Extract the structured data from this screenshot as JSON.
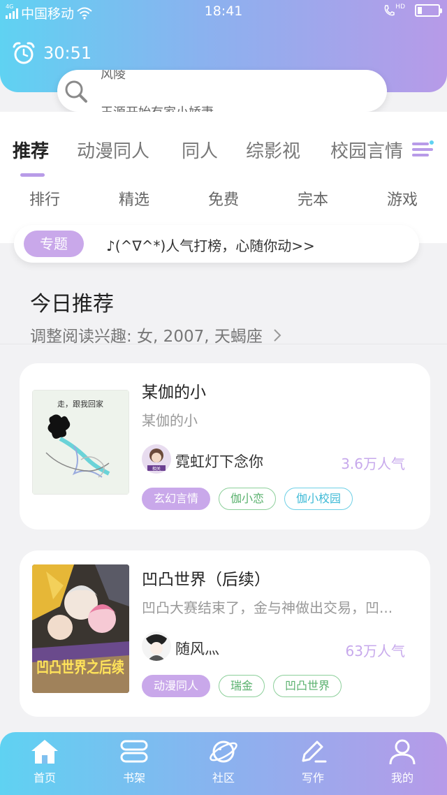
{
  "status_bar": {
    "network": "4G",
    "carrier": "中国移动",
    "time": "18:41",
    "call_indicator": "HD",
    "icons": [
      "signal-icon",
      "wifi-icon",
      "hd-call-icon",
      "battery-icon"
    ]
  },
  "timer": {
    "value": "30:51",
    "icon": "alarm-clock-icon"
  },
  "search": {
    "icon": "search-icon",
    "hint_primary": "风陵",
    "hint_secondary": "王源开始有家小娇妻"
  },
  "tabs": [
    {
      "label": "推荐",
      "active": true
    },
    {
      "label": "动漫同人"
    },
    {
      "label": "同人"
    },
    {
      "label": "综影视"
    },
    {
      "label": "校园言情"
    }
  ],
  "subtabs": [
    "排行",
    "精选",
    "免费",
    "完本",
    "游戏"
  ],
  "topic": {
    "badge": "专题",
    "text": "♪(^∇^*)人气打榜，心随你动>>"
  },
  "today": {
    "title": "今日推荐",
    "interest": "调整阅读兴趣: 女, 2007, 天蝎座"
  },
  "books": [
    {
      "title": "某伽的小",
      "desc": "某伽的小",
      "author": "霓虹灯下念你",
      "popularity": "3.6万人气",
      "cover_caption": "走，跟我回家",
      "avatar_caption": "相关",
      "tags": [
        {
          "label": "玄幻言情",
          "style": "purple"
        },
        {
          "label": "伽小恋",
          "style": "green"
        },
        {
          "label": "伽小校园",
          "style": "cyan"
        }
      ]
    },
    {
      "title": "凹凸世界（后续）",
      "desc": "凹凸大赛结束了，金与神做出交易，凹...",
      "author": "随风灬",
      "popularity": "63万人气",
      "cover_caption": "凹凸世界之后续",
      "tags": [
        {
          "label": "动漫同人",
          "style": "purple"
        },
        {
          "label": "瑞金",
          "style": "green"
        },
        {
          "label": "凹凸世界",
          "style": "green"
        }
      ]
    }
  ],
  "bottom_nav": [
    {
      "label": "首页",
      "icon": "home-icon",
      "active": true
    },
    {
      "label": "书架",
      "icon": "bookshelf-icon"
    },
    {
      "label": "社区",
      "icon": "planet-icon"
    },
    {
      "label": "写作",
      "icon": "pen-icon"
    },
    {
      "label": "我的",
      "icon": "user-icon"
    }
  ],
  "colors": {
    "gradient_start": "#5fd2f2",
    "gradient_end": "#b79ae8",
    "accent_purple": "#c9a8ea",
    "popularity": "#c7a9ec",
    "tag_green": "#58b06c",
    "tag_cyan": "#3cb9d6"
  }
}
